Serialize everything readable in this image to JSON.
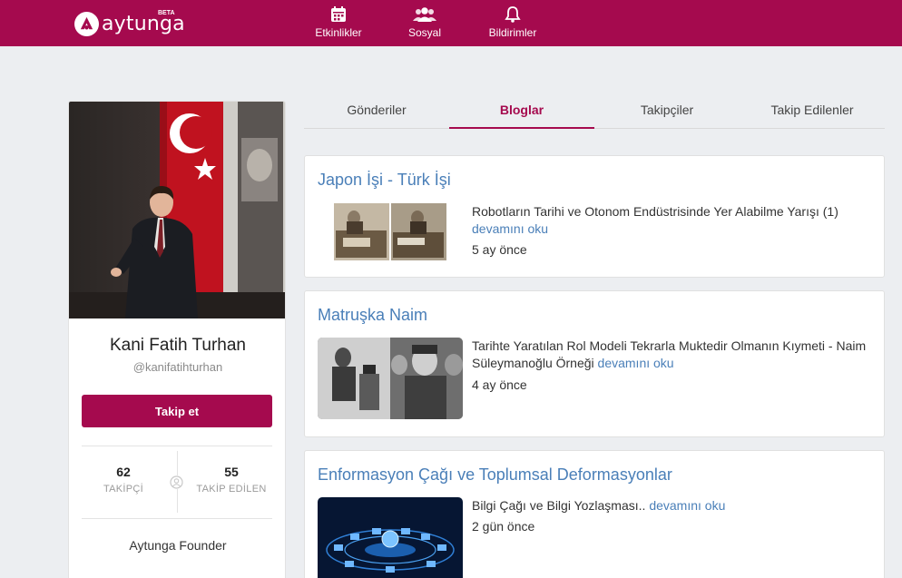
{
  "brand": {
    "name": "aytunga",
    "badge": "BETA"
  },
  "nav": {
    "events": "Etkinlikler",
    "social": "Sosyal",
    "notifications": "Bildirimler"
  },
  "profile": {
    "name": "Kani Fatih Turhan",
    "handle": "@kanifatihturhan",
    "follow_label": "Takip et",
    "followers_count": "62",
    "followers_label": "TAKİPÇİ",
    "following_count": "55",
    "following_label": "TAKİP EDİLEN",
    "bio": "Aytunga Founder"
  },
  "tabs": {
    "posts": "Gönderiler",
    "blogs": "Bloglar",
    "followers": "Takipçiler",
    "following": "Takip Edilenler"
  },
  "blogs": [
    {
      "title": "Japon İşi - Türk İşi",
      "excerpt": "Robotların Tarihi ve Otonom Endüstrisinde Yer Alabilme Yarışı (1)",
      "read_more": "devamını oku",
      "time": "5 ay önce"
    },
    {
      "title": "Matruşka Naim",
      "excerpt": "Tarihte Yaratılan Rol Modeli Tekrarla Muktedir Olmanın Kıymeti - Naim Süleymanoğlu Örneği",
      "read_more": "devamını oku",
      "time": "4 ay önce"
    },
    {
      "title": "Enformasyon Çağı ve Toplumsal Deformasyonlar",
      "excerpt": "Bilgi Çağı ve Bilgi Yozlaşması..",
      "read_more": "devamını oku",
      "time": "2 gün önce"
    }
  ],
  "colors": {
    "brand": "#a50a4e",
    "link": "#4a7fb8",
    "background": "#eceef1"
  },
  "icons": {
    "logo": "aytunga-logo-icon",
    "events": "calendar-icon",
    "social": "group-icon",
    "notifications": "bell-icon",
    "stats": "user-circle-icon"
  }
}
